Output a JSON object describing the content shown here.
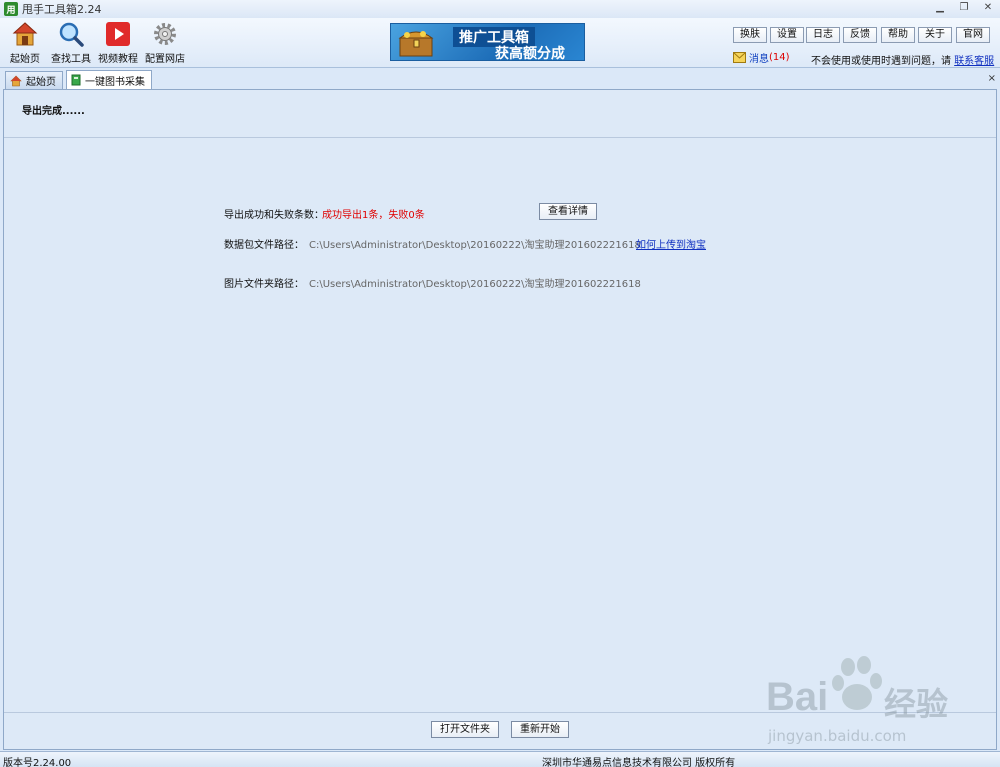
{
  "window": {
    "logo_char": "用",
    "title": "甩手工具箱2.24",
    "min": "▁",
    "restore": "❐",
    "close": "✕"
  },
  "toolbar": {
    "home_label": "起始页",
    "find_tools_label": "查找工具",
    "video_label": "视频教程",
    "config_shop_label": "配置网店"
  },
  "banner": {
    "line1": "推广工具箱",
    "line2": "获高额分成"
  },
  "top_buttons": {
    "skin": "换肤",
    "settings": "设置",
    "log": "日志",
    "feedback": "反馈",
    "help": "帮助",
    "about": "关于",
    "official": "官网"
  },
  "messages": {
    "label": "消息",
    "count": "(14)"
  },
  "help_bar": {
    "text": "不会使用或使用时遇到问题，请",
    "link": "联系客服"
  },
  "tabs": {
    "home": "起始页",
    "collect": "一键图书采集",
    "close": "×"
  },
  "content": {
    "status": "导出完成......",
    "result_label": "导出成功和失败条数：",
    "result_value": "成功导出1条，失败0条",
    "details_button": "查看详情",
    "package_label": "数据包文件路径：",
    "package_path": "C:\\Users\\Administrator\\Desktop\\20160222\\淘宝助理201602221618",
    "upload_link": "如何上传到淘宝",
    "image_label": "图片文件夹路径：",
    "image_path": "C:\\Users\\Administrator\\Desktop\\20160222\\淘宝助理201602221618",
    "open_folder_button": "打开文件夹",
    "restart_button": "重新开始"
  },
  "statusbar": {
    "version": "版本号2.24.00",
    "copyright": "深圳市华通易点信息技术有限公司 版权所有"
  },
  "watermark": {
    "brand": "Bai",
    "brand2": "经验",
    "url": "jingyan.baidu.com"
  },
  "colors": {
    "accent_red": "#e00000",
    "link_blue": "#1030c0",
    "background": "#dde9f7"
  }
}
